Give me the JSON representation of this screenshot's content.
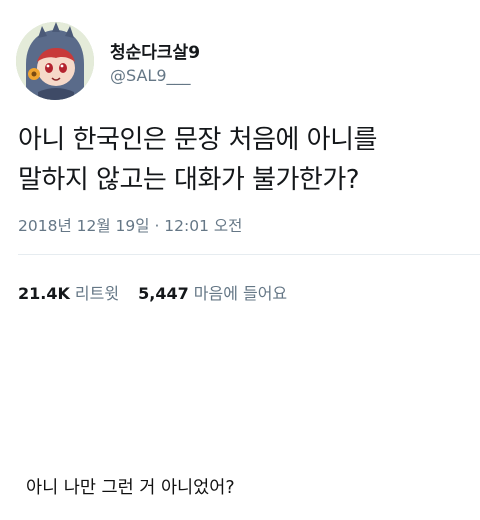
{
  "tweet": {
    "display_name": "청순다크살9",
    "handle": "@SAL9___",
    "text_lines": [
      "아니 한국인은 문장 처음에 아니를",
      "말하지 않고는 대화가 불가한가?"
    ],
    "timestamp": "2018년 12월 19일 · 12:01 오전",
    "stats": {
      "retweets_count": "21.4K",
      "retweets_label": "리트윗",
      "likes_count": "5,447",
      "likes_label": "마음에 들어요"
    }
  },
  "caption": "아니 나만 그런 거 아니었어?",
  "colors": {
    "text_primary": "#14171a",
    "text_secondary": "#657786",
    "divider": "#e6ecf0",
    "background": "#ffffff"
  },
  "icons": {
    "avatar": "anime-character-avatar"
  }
}
